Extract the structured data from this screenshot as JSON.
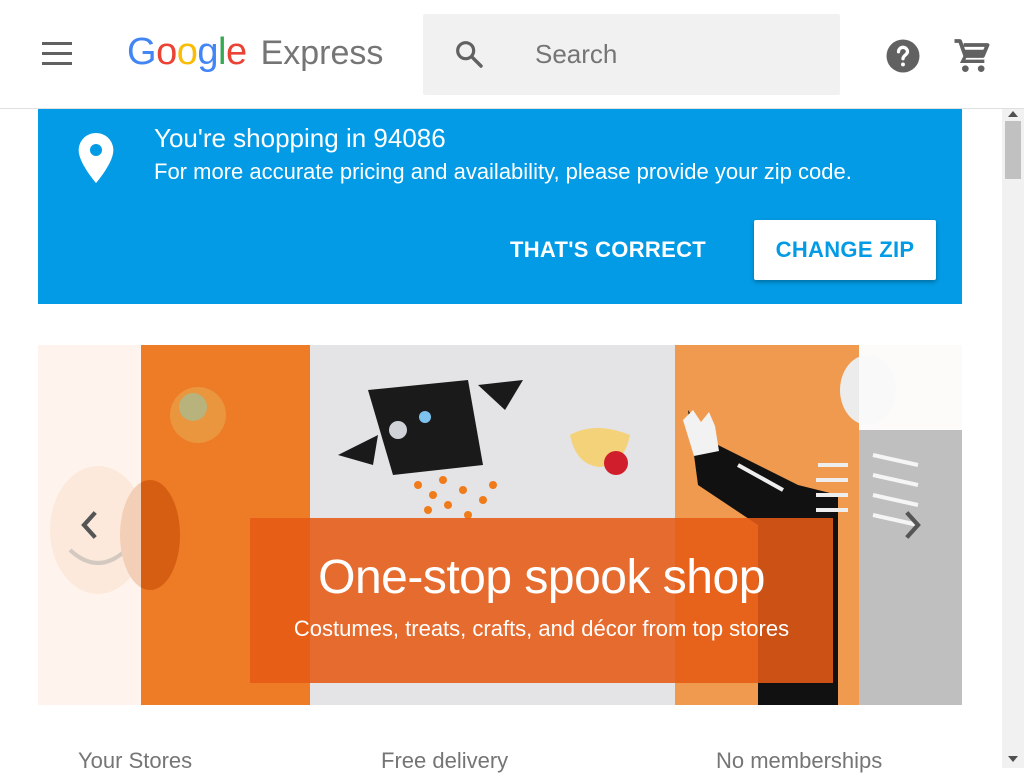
{
  "header": {
    "logo_letters": [
      "G",
      "o",
      "o",
      "g",
      "l",
      "e"
    ],
    "product": "Express",
    "search": {
      "placeholder": "Search",
      "value": ""
    },
    "icons": [
      "menu-icon",
      "search-icon",
      "help-icon",
      "cart-icon"
    ]
  },
  "zip_banner": {
    "title": "You're shopping in 94086",
    "subtitle": "For more accurate pricing and availability, please provide your zip code.",
    "confirm_label": "THAT'S CORRECT",
    "change_label": "CHANGE ZIP",
    "icon": "location-pin-icon",
    "color": "#039be5"
  },
  "hero": {
    "title": "One-stop spook shop",
    "subtitle": "Costumes, treats, crafts, and décor from top stores",
    "card_color": "#e65a14",
    "icons": [
      "chevron-left-icon",
      "chevron-right-icon"
    ]
  },
  "value_props": [
    "Your Stores",
    "Free delivery",
    "No memberships"
  ]
}
